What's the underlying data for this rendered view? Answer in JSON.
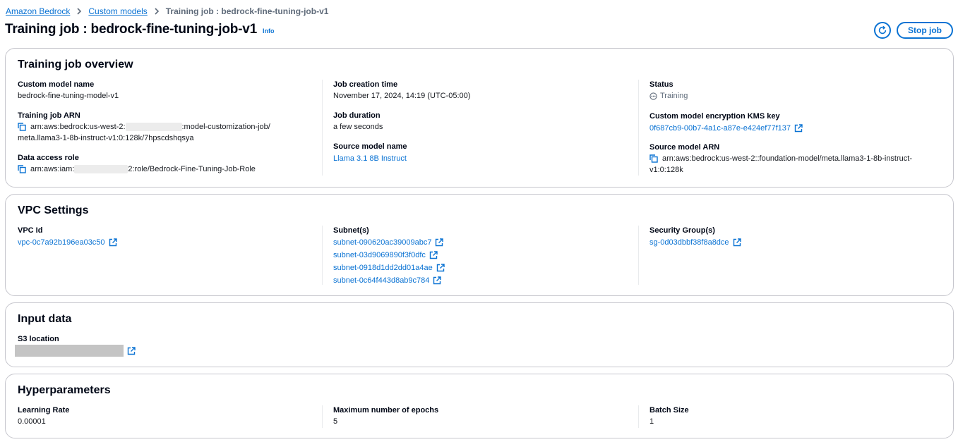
{
  "breadcrumb": {
    "items": [
      "Amazon Bedrock",
      "Custom models"
    ],
    "current": "Training job : bedrock-fine-tuning-job-v1"
  },
  "header": {
    "title": "Training job : bedrock-fine-tuning-job-v1",
    "info_label": "Info",
    "stop_label": "Stop job"
  },
  "overview": {
    "title": "Training job overview",
    "custom_model_name_label": "Custom model name",
    "custom_model_name": "bedrock-fine-tuning-model-v1",
    "training_job_arn_label": "Training job ARN",
    "training_job_arn_prefix": "arn:aws:bedrock:us-west-2:",
    "training_job_arn_suffix": ":model-customization-job/",
    "training_job_arn_line2": "meta.llama3-1-8b-instruct-v1:0:128k/7hpscdshqsya",
    "data_access_role_label": "Data access role",
    "data_access_role_prefix": "arn:aws:iam:",
    "data_access_role_suffix": "2:role/Bedrock-Fine-Tuning-Job-Role",
    "job_creation_time_label": "Job creation time",
    "job_creation_time": "November 17, 2024, 14:19 (UTC-05:00)",
    "job_duration_label": "Job duration",
    "job_duration": "a few seconds",
    "source_model_name_label": "Source model name",
    "source_model_name": "Llama 3.1 8B Instruct",
    "status_label": "Status",
    "status": "Training",
    "kms_key_label": "Custom model encryption KMS key",
    "kms_key": "0f687cb9-00b7-4a1c-a87e-e424ef77f137",
    "source_model_arn_label": "Source model ARN",
    "source_model_arn_line1": "arn:aws:bedrock:us-west-2::foundation-model/meta.llama3-1-8b-instruct-",
    "source_model_arn_line2": "v1:0:128k"
  },
  "vpc": {
    "title": "VPC Settings",
    "vpc_id_label": "VPC Id",
    "vpc_id": "vpc-0c7a92b196ea03c50",
    "subnets_label": "Subnet(s)",
    "subnets": [
      "subnet-090620ac39009abc7",
      "subnet-03d9069890f3f0dfc",
      "subnet-0918d1dd2dd01a4ae",
      "subnet-0c64f443d8ab9c784"
    ],
    "security_groups_label": "Security Group(s)",
    "security_group": "sg-0d03dbbf38f8a8dce"
  },
  "input": {
    "title": "Input data",
    "s3_location_label": "S3 location"
  },
  "hyper": {
    "title": "Hyperparameters",
    "learning_rate_label": "Learning Rate",
    "learning_rate": "0.00001",
    "epochs_label": "Maximum number of epochs",
    "epochs": "5",
    "batch_size_label": "Batch Size",
    "batch_size": "1"
  },
  "colors": {
    "link": "#0972d3",
    "border": "#c6c6cd",
    "text": "#16191f"
  },
  "icons": [
    "chevron-right-icon",
    "refresh-icon",
    "copy-icon",
    "external-link-icon",
    "status-pending-icon"
  ]
}
